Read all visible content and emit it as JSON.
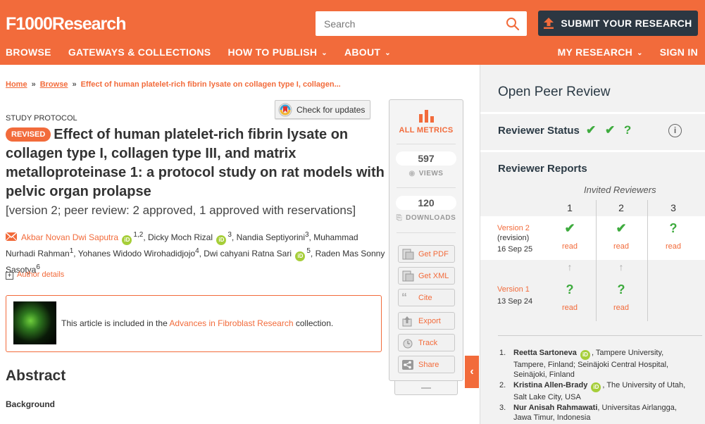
{
  "header": {
    "logo": "F1000Research",
    "search_placeholder": "Search",
    "submit_label": "SUBMIT YOUR RESEARCH",
    "nav_left": [
      "BROWSE",
      "GATEWAYS & COLLECTIONS",
      "HOW TO PUBLISH",
      "ABOUT"
    ],
    "nav_right": [
      "MY RESEARCH",
      "SIGN IN"
    ]
  },
  "breadcrumb": {
    "home": "Home",
    "browse": "Browse",
    "current": "Effect of human platelet-rich fibrin lysate on collagen type I, collagen..."
  },
  "article": {
    "type": "STUDY PROTOCOL",
    "check_updates": "Check for updates",
    "badge": "REVISED",
    "title": "Effect of human platelet-rich fibrin lysate on collagen type I, collagen type III, and matrix metalloproteinase 1: a protocol study on rat models with pelvic organ prolapse",
    "version_line": "[version 2; peer review: 2 approved, 1 approved with reservations]",
    "authors": {
      "a1": "Akbar Novan Dwi Saputra",
      "a1_sup": "1,2",
      "a2": ", Dicky Moch Rizal",
      "a2_sup": "3",
      "a3": ", Nandia Septiyorini",
      "a3_sup": "3",
      "a4": ", Muhammad Nurhadi Rahman",
      "a4_sup": "1",
      "a5": ", Yohanes Widodo Wirohadidjojo",
      "a5_sup": "4",
      "a6": ", Dwi cahyani Ratna Sari",
      "a6_sup": "5",
      "a7": ", Raden Mas Sonny Sasotya",
      "a7_sup": "6",
      "orcid": "iD"
    },
    "author_details": "Author details",
    "collection_prefix": "This article is included in the ",
    "collection_link": "Advances in Fibroblast Research",
    "collection_suffix": " collection.",
    "abstract_heading": "Abstract",
    "background_heading": "Background"
  },
  "metrics": {
    "all_metrics": "ALL METRICS",
    "views_count": "597",
    "views_label": "VIEWS",
    "downloads_count": "120",
    "downloads_label": "DOWNLOADS",
    "buttons": [
      "Get PDF",
      "Get XML",
      "Cite",
      "Export",
      "Track",
      "Share"
    ]
  },
  "peer_review": {
    "title": "Open Peer Review",
    "status_label": "Reviewer Status",
    "status_icons": "✔ ✔ ?",
    "info": "i",
    "reports_label": "Reviewer Reports",
    "invited": "Invited Reviewers",
    "reviewer_nums": [
      "1",
      "2",
      "3"
    ],
    "version2": {
      "name": "Version 2",
      "sub": "(revision)",
      "date": "16 Sep 25"
    },
    "version1": {
      "name": "Version 1",
      "date": "13 Sep 24"
    },
    "read": "read",
    "reviewers": [
      {
        "num": "1.",
        "name": "Reetta Sartoneva",
        "affil": ", Tampere University, Tampere, Finland; Seinäjoki Central Hospital, Seinäjoki, Finland"
      },
      {
        "num": "2.",
        "name": "Kristina Allen-Brady",
        "affil": ", The University of Utah, Salt Lake City, USA"
      },
      {
        "num": "3.",
        "name": "Nur Anisah Rahmawati",
        "affil": ", Universitas Airlangga, Jawa Timur, Indonesia"
      }
    ]
  },
  "colors": {
    "brand": "#f26b3b",
    "dark": "#2c3742",
    "approved": "#3eab3e"
  }
}
